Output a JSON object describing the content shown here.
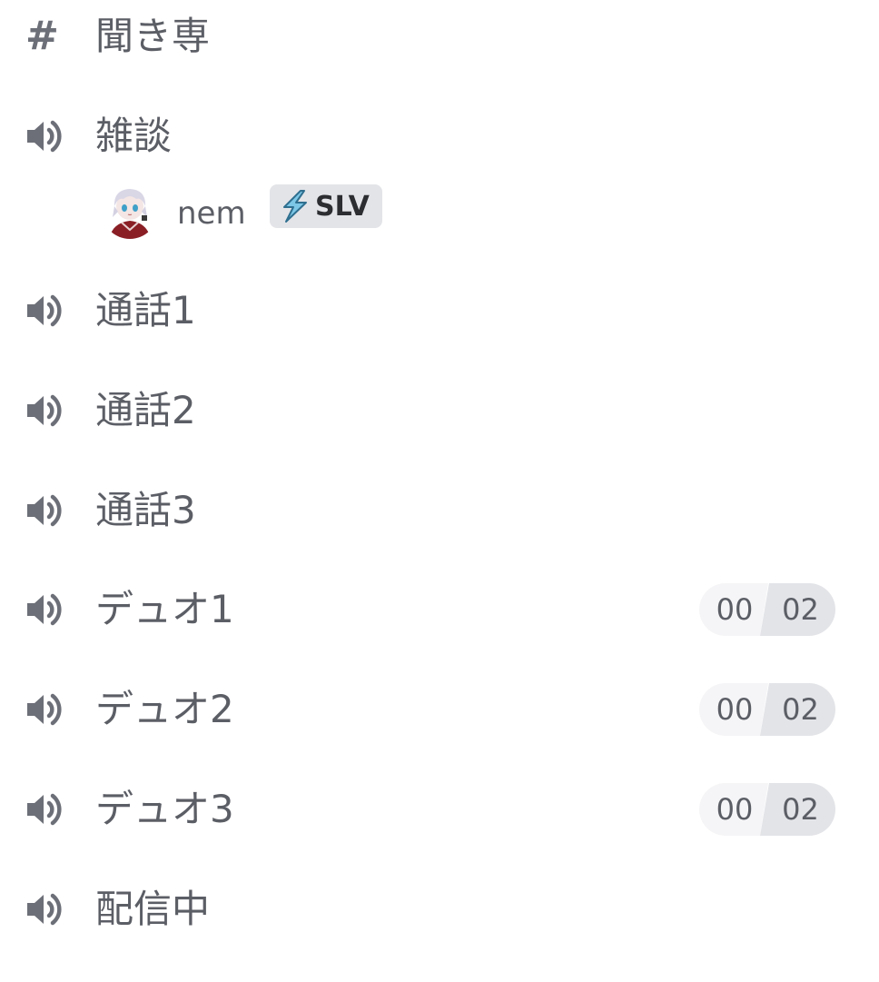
{
  "channels": [
    {
      "type": "text",
      "name": "聞き専",
      "icon": "hash-icon"
    },
    {
      "type": "voice",
      "name": "雑談",
      "icon": "speaker-icon",
      "users": [
        {
          "name": "nem",
          "badge": "SLV",
          "badge_icon": "lightning-icon"
        }
      ]
    },
    {
      "type": "voice",
      "name": "通話1",
      "icon": "speaker-icon"
    },
    {
      "type": "voice",
      "name": "通話2",
      "icon": "speaker-icon"
    },
    {
      "type": "voice",
      "name": "通話3",
      "icon": "speaker-icon"
    },
    {
      "type": "voice",
      "name": "デュオ1",
      "icon": "speaker-icon",
      "user_count": "00",
      "user_limit": "02"
    },
    {
      "type": "voice",
      "name": "デュオ2",
      "icon": "speaker-icon",
      "user_count": "00",
      "user_limit": "02"
    },
    {
      "type": "voice",
      "name": "デュオ3",
      "icon": "speaker-icon",
      "user_count": "00",
      "user_limit": "02"
    },
    {
      "type": "voice",
      "name": "配信中",
      "icon": "speaker-icon"
    }
  ],
  "colors": {
    "text": "#5c5e66",
    "icon": "#6d6f78",
    "badge_bg": "#e3e4e8",
    "limit_left_bg": "#f5f5f7",
    "limit_right_bg": "#e3e4e8",
    "bolt": "#7cc6e6"
  }
}
